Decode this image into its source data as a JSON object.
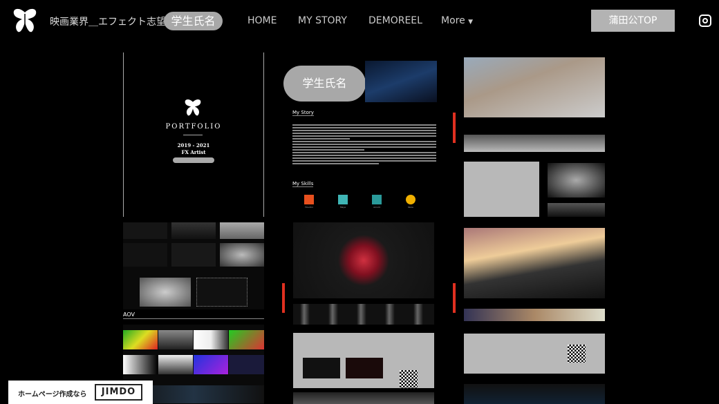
{
  "header": {
    "site_title": "映画業界＿エフェクト志望",
    "student_name": "学生氏名",
    "nav": [
      {
        "label": "HOME"
      },
      {
        "label": "MY STORY"
      },
      {
        "label": "DEMOREEL"
      },
      {
        "label": "More"
      }
    ],
    "cta": "蒲田公TOP",
    "social": "instagram-icon"
  },
  "cover": {
    "title": "PORTFOLIO",
    "years": "2019 - 2021",
    "role": "FX Artist"
  },
  "left": {
    "aov_label": "AOV"
  },
  "middle": {
    "name_pill": "学生氏名",
    "story_heading": "My Story",
    "skills_heading": "My Skills",
    "skills": [
      {
        "name": "Houdini",
        "color": "#e8501e"
      },
      {
        "name": "Maya",
        "color": "#3fb5b5"
      },
      {
        "name": "Arnold",
        "color": "#2a9a9a"
      },
      {
        "name": "Nuke",
        "color": "#f0b000"
      }
    ]
  },
  "footer": {
    "jimdo_text": "ホームページ作成なら",
    "jimdo_logo": "JIMDO"
  },
  "colors": {
    "accent_red": "#e03020",
    "pill_gray": "#a8a8a8"
  }
}
